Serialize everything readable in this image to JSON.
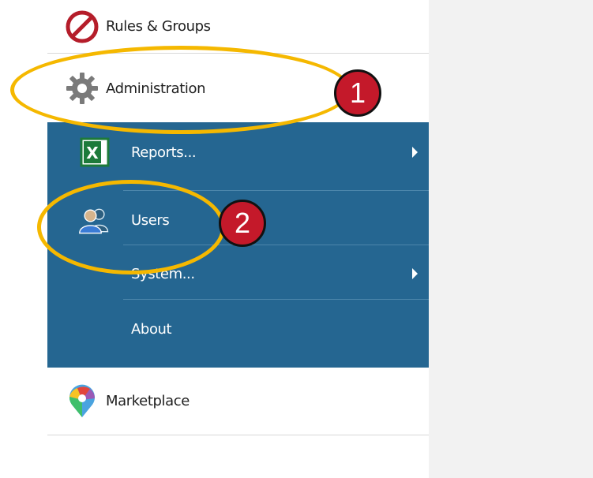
{
  "sidebar": {
    "rules_groups": {
      "label": "Rules & Groups",
      "icon": "no-entry-icon"
    },
    "administration": {
      "label": "Administration",
      "icon": "gear-icon"
    },
    "marketplace": {
      "label": "Marketplace",
      "icon": "map-pin-icon"
    }
  },
  "submenu": {
    "items": [
      {
        "label": "Reports...",
        "icon": "excel-icon",
        "has_submenu": true
      },
      {
        "label": "Users",
        "icon": "users-icon",
        "has_submenu": false
      },
      {
        "label": "System...",
        "icon": "",
        "has_submenu": true
      },
      {
        "label": "About",
        "icon": "",
        "has_submenu": false
      }
    ]
  },
  "annotations": {
    "badge1": "1",
    "badge2": "2"
  },
  "colors": {
    "submenu_bg": "#256691",
    "highlight": "#f5b800",
    "badge": "#c4192a",
    "content_bg": "#f2f2f2"
  }
}
